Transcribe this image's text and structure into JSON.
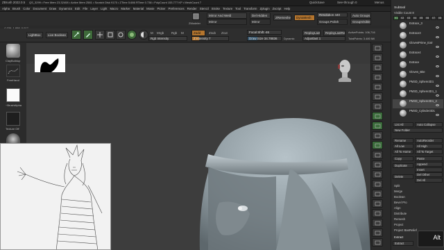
{
  "titlebar": {
    "left": "ZBrush 2022.0.5",
    "memory": "QS_3299  • Free Mem 23.32408 • Active Mem 2581 • Scratch Disk 9170 • ZTime 5.686 RTime 0.738 • PolyCount 153.777 KP • MeshCount 7",
    "quicksave": "QuickSave",
    "seethrough": "See-through 0",
    "menus": "Menus",
    "defaultscript": "DefaultZScript"
  },
  "menubar": [
    "Alpha",
    "Brush",
    "Color",
    "Document",
    "Draw",
    "Dynamics",
    "Edit",
    "File",
    "Layer",
    "Light",
    "Macro",
    "Marker",
    "Material",
    "Movie",
    "Picker",
    "Preferences",
    "Render",
    "Stencil",
    "Stroke",
    "Texture",
    "Tool",
    "Transform",
    "Zplugin",
    "Zscript",
    "Help"
  ],
  "topshelf": {
    "zmodeler_label": "ZModeler",
    "mirror_weld": "Mirror And Weld",
    "mirror": "Mirror",
    "del_hidden": "Del Hidden",
    "mirror2": "Mirror",
    "zremesher": "ZRemesher",
    "dynamesh": "DynaMesh",
    "resolution": "Resolution 440",
    "groups_polish": "Groups  Polish",
    "auto_groups": "Auto Groups",
    "group_visible": "GroupVisible"
  },
  "coord_readout": "-0.326, 1.958, 0.017",
  "toolbar": {
    "lightbox": "LightBox",
    "live_boolean": "Live Boolean",
    "edit": "Edit",
    "draw": "Draw",
    "move": "Move",
    "scale": "Scale",
    "rotate": "Rotate",
    "m_label": "M",
    "mrgb": "Mrgb",
    "rgb": "Rgb",
    "m2": "M",
    "zadd": "Zadd",
    "zsub": "Zsub",
    "zcut": "Zcut",
    "rgb_intensity": "Rgb Intensity",
    "z_intensity": "Z Intensity 7",
    "focal_shift": "Focal Shift -46",
    "draw_size": "Draw Size 34.78836",
    "dynamic": "Dynamic",
    "replay_last": "ReplayLast",
    "replay_last_rel": "ReplayLastRel",
    "adjust": "Adjustlast 1",
    "active_points": "ActivePoints: 106,716",
    "total_points": "TotalPoints: 3.480 Mil"
  },
  "left_shelf": {
    "brush_name": "ClayBuildup",
    "stroke_name": "FreeHand",
    "alpha_name": "~BrushAlpha",
    "texture_name": "Texture Off"
  },
  "right_tool": {
    "title": "Subtool",
    "visible_count": "Visible Count 8",
    "v_buttons": [
      "V1",
      "V2",
      "V3",
      "V4",
      "V5",
      "V6",
      "V7",
      "V8"
    ],
    "subtools": [
      {
        "name": "Extrace_3"
      },
      {
        "name": "Extrace3"
      },
      {
        "name": "GlovesPrime_Extr"
      },
      {
        "name": "Extrace4"
      },
      {
        "name": "Extrace"
      },
      {
        "name": "Gloves_Bite"
      },
      {
        "name": "PM3D_Sphere3D1"
      },
      {
        "name": "PM3D_Sphere3D1_1"
      },
      {
        "name": "PM3D_Sphere3D1_2"
      },
      {
        "name": "PM3D_Cylinder3D1"
      }
    ],
    "list_all": "List All",
    "auto_collapse": "Auto Collapse",
    "new_folder": "New Folder",
    "rename": "Rename",
    "auto_reorder": "AutoReorder",
    "all_low": "All Low",
    "all_high": "All High",
    "all_to_home": "All To Home",
    "all_to_target": "All To Target",
    "copy": "Copy",
    "paste": "Paste",
    "append": "Append",
    "duplicate": "Duplicate",
    "insert": "Insert",
    "delete": "Delete",
    "del_other": "Del Other",
    "del_all": "Del All",
    "split": "Split",
    "merge": "Merge",
    "boolean": "Boolean",
    "bevel_pro": "Bevel Pro",
    "align": "Align",
    "distribute": "Distribute",
    "remesh": "Remesh",
    "project": "Project",
    "project_bas_relief": "Project BasRelief",
    "extract": "Extract",
    "extract_btn": "Extract"
  },
  "right_shelf_icons": [
    "bpr-icon",
    "spix-icon",
    "scroll-icon",
    "zoom-icon",
    "actual-icon",
    "aahalf-icon",
    "persp-icon",
    "floor-icon",
    "local-icon",
    "lsym-icon",
    "xyz-icon",
    "frame-icon",
    "move-icon",
    "scale-icon",
    "rotate-icon",
    "linefill-icon",
    "polyf-icon",
    "transp-icon",
    "ghost-icon",
    "solo-icon",
    "xpose-icon"
  ],
  "overlay": {
    "alt_badge": "Alt"
  },
  "colors": {
    "accent_orange": "#b4752e",
    "canvas_bg": "#3e3e3e",
    "model": "#9aa7ad",
    "active_green": "#3a6b3a"
  }
}
